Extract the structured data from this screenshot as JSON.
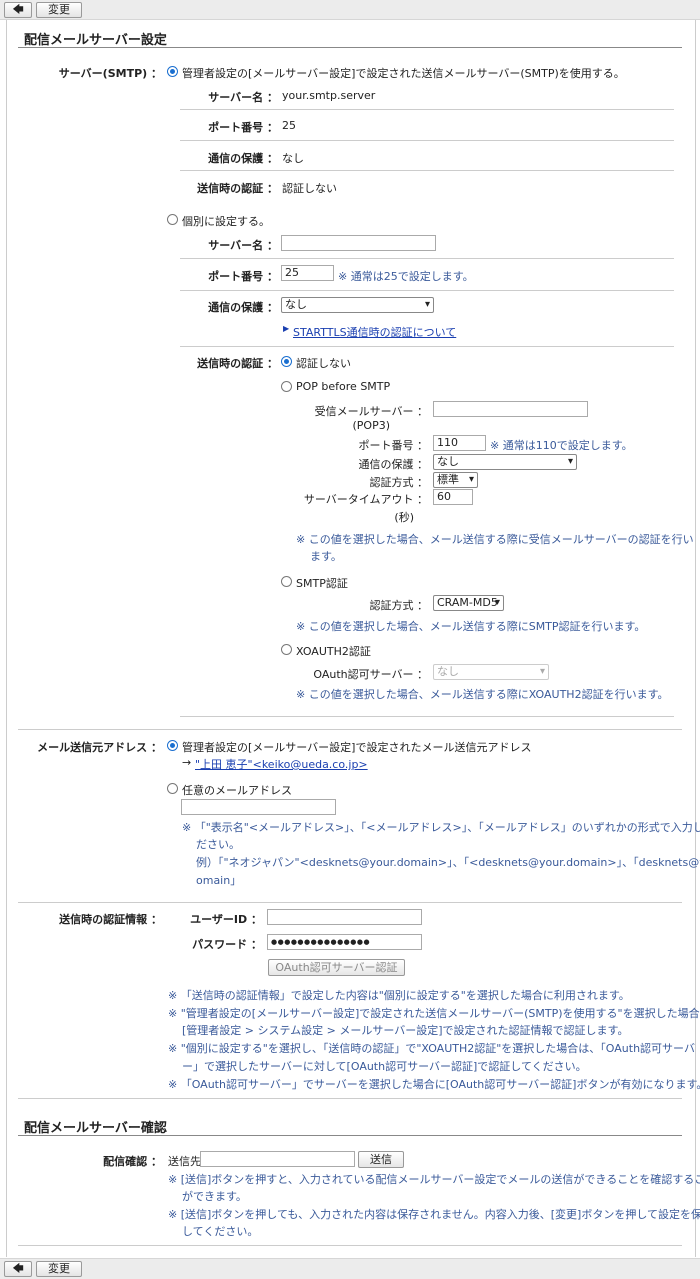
{
  "toolbar": {
    "back": "🡄",
    "change": "変更"
  },
  "delivery": {
    "title": "配信メールサーバー設定",
    "server_label": "サーバー(SMTP) ：",
    "admin_option": "管理者設定の[メールサーバー設定]で設定された送信メールサーバー(SMTP)を使用する。",
    "admin_rows": [
      {
        "label": "サーバー名 ：",
        "value": "your.smtp.server"
      },
      {
        "label": "ポート番号 ：",
        "value": "25"
      },
      {
        "label": "通信の保護 ：",
        "value": "なし"
      },
      {
        "label": "送信時の認証 ：",
        "value": "認証しない"
      }
    ],
    "custom_option": "個別に設定する。",
    "custom_server_label": "サーバー名 ：",
    "custom_server_value": "",
    "custom_port_label": "ポート番号 ：",
    "custom_port_value": "25",
    "custom_port_note": "※ 通常は25で設定します。",
    "custom_security_label": "通信の保護 ：",
    "custom_security_value": "なし",
    "starttls_link": "STARTTLS通信時の認証について",
    "auth_label": "送信時の認証 ：",
    "auth_none": "認証しない",
    "pop_option": "POP before SMTP",
    "pop_recv_label": "受信メールサーバー ：",
    "pop_recv_label2": "(POP3)",
    "pop_recv_value": "",
    "pop_port_label": "ポート番号 ：",
    "pop_port_value": "110",
    "pop_port_note": "※ 通常は110で設定します。",
    "pop_security_label": "通信の保護 ：",
    "pop_security_value": "なし",
    "pop_method_label": "認証方式 ：",
    "pop_method_value": "標準",
    "pop_timeout_label": "サーバータイムアウト ：",
    "pop_timeout_label2": "(秒)",
    "pop_timeout_value": "60",
    "pop_note_1": "※ この値を選択した場合、メール送信する際に受信メールサーバーの認証を行い",
    "pop_note_2": "ます。",
    "smtp_option": "SMTP認証",
    "smtp_method_label": "認証方式 ：",
    "smtp_method_value": "CRAM-MD5",
    "smtp_note": "※ この値を選択した場合、メール送信する際にSMTP認証を行います。",
    "xoauth_option": "XOAUTH2認証",
    "xoauth_server_label": "OAuth認可サーバー ：",
    "xoauth_server_value": "なし",
    "xoauth_note": "※ この値を選択した場合、メール送信する際にXOAUTH2認証を行います。"
  },
  "from": {
    "label": "メール送信元アドレス ：",
    "admin_option": "管理者設定の[メールサーバー設定]で設定されたメール送信元アドレス",
    "arrow": "→",
    "admin_address": "\"上田 恵子\"<keiko@ueda.co.jp>",
    "custom_option": "任意のメールアドレス",
    "custom_value": "",
    "note_1": "※ 「\"表示名\"<メールアドレス>」、「<メールアドレス>」、「メールアドレス」のいずれかの形式で入力してく",
    "note_2": "ださい。",
    "note_3": "例）「\"ネオジャパン\"<desknets@your.domain>」、「<desknets@your.domain>」、「desknets@your.d",
    "note_4": "omain」"
  },
  "auth_info": {
    "label": "送信時の認証情報 ：",
    "user_label": "ユーザーID ：",
    "user_value": "",
    "pass_label": "パスワード ：",
    "pass_value": "●●●●●●●●●●●●●●●",
    "oauth_button": "OAuth認可サーバー認証",
    "notes": [
      "※ 「送信時の認証情報」で設定した内容は\"個別に設定する\"を選択した場合に利用されます。",
      "※ \"管理者設定の[メールサーバー設定]で設定された送信メールサーバー(SMTP)を使用する\"を選択した場合、",
      "[管理者設定 > システム設定 > メールサーバー設定]で設定された認証情報で認証します。",
      "※ \"個別に設定する\"を選択し、「送信時の認証」で\"XOAUTH2認証\"を選択した場合は、「OAuth認可サーバ",
      "ー」で選択したサーバーに対して[OAuth認可サーバー認証]で認証してください。",
      "※ 「OAuth認可サーバー」でサーバーを選択した場合に[OAuth認可サーバー認証]ボタンが有効になります。"
    ]
  },
  "confirm": {
    "title": "配信メールサーバー確認",
    "label": "配信確認 ：",
    "to_label": "送信先",
    "to_value": "",
    "send_button": "送信",
    "notes": [
      "※ [送信]ボタンを押すと、入力されている配信メールサーバー設定でメールの送信ができることを確認すること",
      "ができます。",
      "※ [送信]ボタンを押しても、入力された内容は保存されません。内容入力後、[変更]ボタンを押して設定を保存",
      "してください。"
    ]
  }
}
